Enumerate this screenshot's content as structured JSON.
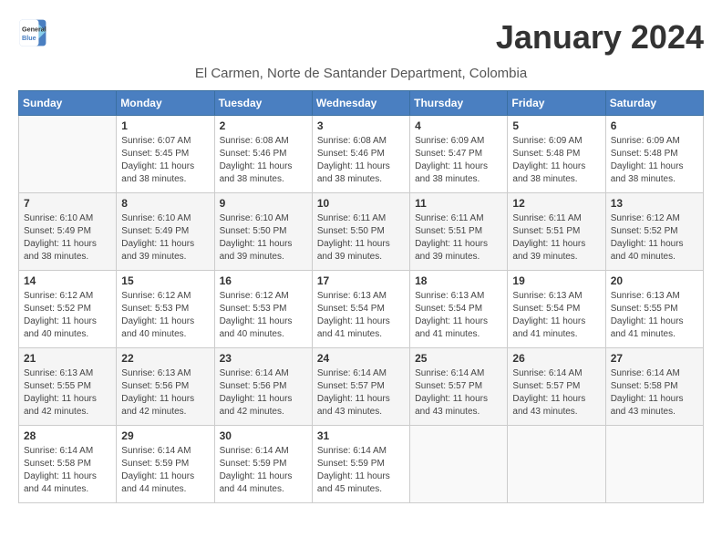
{
  "header": {
    "logo_line1": "General",
    "logo_line2": "Blue",
    "month_title": "January 2024",
    "location": "El Carmen, Norte de Santander Department, Colombia"
  },
  "weekdays": [
    "Sunday",
    "Monday",
    "Tuesday",
    "Wednesday",
    "Thursday",
    "Friday",
    "Saturday"
  ],
  "weeks": [
    [
      {
        "day": "",
        "sunrise": "",
        "sunset": "",
        "daylight": ""
      },
      {
        "day": "1",
        "sunrise": "Sunrise: 6:07 AM",
        "sunset": "Sunset: 5:45 PM",
        "daylight": "Daylight: 11 hours and 38 minutes."
      },
      {
        "day": "2",
        "sunrise": "Sunrise: 6:08 AM",
        "sunset": "Sunset: 5:46 PM",
        "daylight": "Daylight: 11 hours and 38 minutes."
      },
      {
        "day": "3",
        "sunrise": "Sunrise: 6:08 AM",
        "sunset": "Sunset: 5:46 PM",
        "daylight": "Daylight: 11 hours and 38 minutes."
      },
      {
        "day": "4",
        "sunrise": "Sunrise: 6:09 AM",
        "sunset": "Sunset: 5:47 PM",
        "daylight": "Daylight: 11 hours and 38 minutes."
      },
      {
        "day": "5",
        "sunrise": "Sunrise: 6:09 AM",
        "sunset": "Sunset: 5:48 PM",
        "daylight": "Daylight: 11 hours and 38 minutes."
      },
      {
        "day": "6",
        "sunrise": "Sunrise: 6:09 AM",
        "sunset": "Sunset: 5:48 PM",
        "daylight": "Daylight: 11 hours and 38 minutes."
      }
    ],
    [
      {
        "day": "7",
        "sunrise": "Sunrise: 6:10 AM",
        "sunset": "Sunset: 5:49 PM",
        "daylight": "Daylight: 11 hours and 38 minutes."
      },
      {
        "day": "8",
        "sunrise": "Sunrise: 6:10 AM",
        "sunset": "Sunset: 5:49 PM",
        "daylight": "Daylight: 11 hours and 39 minutes."
      },
      {
        "day": "9",
        "sunrise": "Sunrise: 6:10 AM",
        "sunset": "Sunset: 5:50 PM",
        "daylight": "Daylight: 11 hours and 39 minutes."
      },
      {
        "day": "10",
        "sunrise": "Sunrise: 6:11 AM",
        "sunset": "Sunset: 5:50 PM",
        "daylight": "Daylight: 11 hours and 39 minutes."
      },
      {
        "day": "11",
        "sunrise": "Sunrise: 6:11 AM",
        "sunset": "Sunset: 5:51 PM",
        "daylight": "Daylight: 11 hours and 39 minutes."
      },
      {
        "day": "12",
        "sunrise": "Sunrise: 6:11 AM",
        "sunset": "Sunset: 5:51 PM",
        "daylight": "Daylight: 11 hours and 39 minutes."
      },
      {
        "day": "13",
        "sunrise": "Sunrise: 6:12 AM",
        "sunset": "Sunset: 5:52 PM",
        "daylight": "Daylight: 11 hours and 40 minutes."
      }
    ],
    [
      {
        "day": "14",
        "sunrise": "Sunrise: 6:12 AM",
        "sunset": "Sunset: 5:52 PM",
        "daylight": "Daylight: 11 hours and 40 minutes."
      },
      {
        "day": "15",
        "sunrise": "Sunrise: 6:12 AM",
        "sunset": "Sunset: 5:53 PM",
        "daylight": "Daylight: 11 hours and 40 minutes."
      },
      {
        "day": "16",
        "sunrise": "Sunrise: 6:12 AM",
        "sunset": "Sunset: 5:53 PM",
        "daylight": "Daylight: 11 hours and 40 minutes."
      },
      {
        "day": "17",
        "sunrise": "Sunrise: 6:13 AM",
        "sunset": "Sunset: 5:54 PM",
        "daylight": "Daylight: 11 hours and 41 minutes."
      },
      {
        "day": "18",
        "sunrise": "Sunrise: 6:13 AM",
        "sunset": "Sunset: 5:54 PM",
        "daylight": "Daylight: 11 hours and 41 minutes."
      },
      {
        "day": "19",
        "sunrise": "Sunrise: 6:13 AM",
        "sunset": "Sunset: 5:54 PM",
        "daylight": "Daylight: 11 hours and 41 minutes."
      },
      {
        "day": "20",
        "sunrise": "Sunrise: 6:13 AM",
        "sunset": "Sunset: 5:55 PM",
        "daylight": "Daylight: 11 hours and 41 minutes."
      }
    ],
    [
      {
        "day": "21",
        "sunrise": "Sunrise: 6:13 AM",
        "sunset": "Sunset: 5:55 PM",
        "daylight": "Daylight: 11 hours and 42 minutes."
      },
      {
        "day": "22",
        "sunrise": "Sunrise: 6:13 AM",
        "sunset": "Sunset: 5:56 PM",
        "daylight": "Daylight: 11 hours and 42 minutes."
      },
      {
        "day": "23",
        "sunrise": "Sunrise: 6:14 AM",
        "sunset": "Sunset: 5:56 PM",
        "daylight": "Daylight: 11 hours and 42 minutes."
      },
      {
        "day": "24",
        "sunrise": "Sunrise: 6:14 AM",
        "sunset": "Sunset: 5:57 PM",
        "daylight": "Daylight: 11 hours and 43 minutes."
      },
      {
        "day": "25",
        "sunrise": "Sunrise: 6:14 AM",
        "sunset": "Sunset: 5:57 PM",
        "daylight": "Daylight: 11 hours and 43 minutes."
      },
      {
        "day": "26",
        "sunrise": "Sunrise: 6:14 AM",
        "sunset": "Sunset: 5:57 PM",
        "daylight": "Daylight: 11 hours and 43 minutes."
      },
      {
        "day": "27",
        "sunrise": "Sunrise: 6:14 AM",
        "sunset": "Sunset: 5:58 PM",
        "daylight": "Daylight: 11 hours and 43 minutes."
      }
    ],
    [
      {
        "day": "28",
        "sunrise": "Sunrise: 6:14 AM",
        "sunset": "Sunset: 5:58 PM",
        "daylight": "Daylight: 11 hours and 44 minutes."
      },
      {
        "day": "29",
        "sunrise": "Sunrise: 6:14 AM",
        "sunset": "Sunset: 5:59 PM",
        "daylight": "Daylight: 11 hours and 44 minutes."
      },
      {
        "day": "30",
        "sunrise": "Sunrise: 6:14 AM",
        "sunset": "Sunset: 5:59 PM",
        "daylight": "Daylight: 11 hours and 44 minutes."
      },
      {
        "day": "31",
        "sunrise": "Sunrise: 6:14 AM",
        "sunset": "Sunset: 5:59 PM",
        "daylight": "Daylight: 11 hours and 45 minutes."
      },
      {
        "day": "",
        "sunrise": "",
        "sunset": "",
        "daylight": ""
      },
      {
        "day": "",
        "sunrise": "",
        "sunset": "",
        "daylight": ""
      },
      {
        "day": "",
        "sunrise": "",
        "sunset": "",
        "daylight": ""
      }
    ]
  ]
}
